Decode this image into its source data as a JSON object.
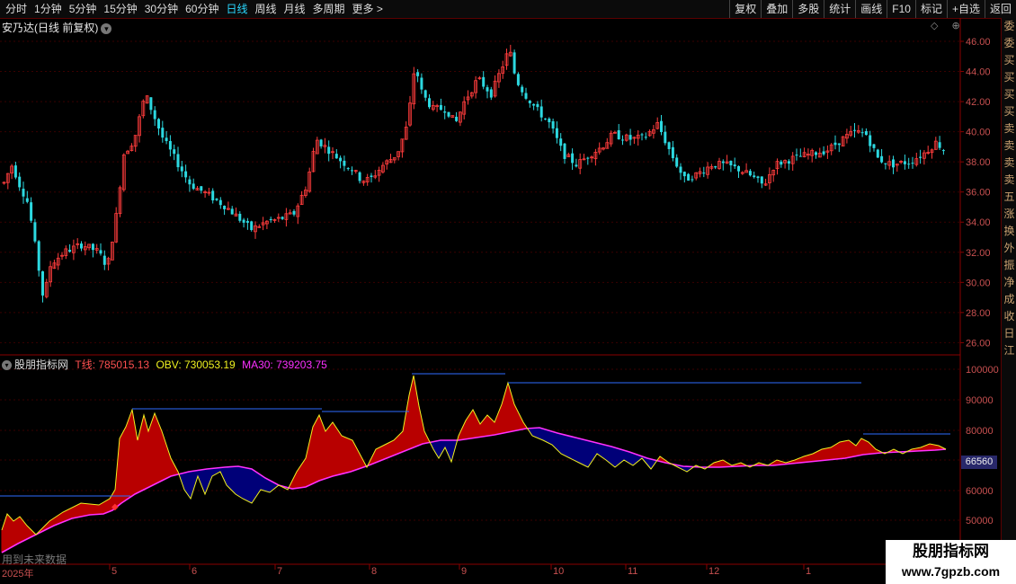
{
  "toolbar": {
    "periods": [
      "分时",
      "1分钟",
      "5分钟",
      "15分钟",
      "30分钟",
      "60分钟",
      "日线",
      "周线",
      "月线",
      "多周期",
      "更多 >"
    ],
    "active_period": "日线",
    "actions": [
      "复权",
      "叠加",
      "多股",
      "统计",
      "画线",
      "F10",
      "标记",
      "+自选",
      "返回"
    ]
  },
  "stock": {
    "title": "安乃达(日线 前复权)",
    "dropdown_glyph": "▾",
    "header_icons": "◇ ⊕"
  },
  "price_axis": {
    "ticks": [
      "46.00",
      "44.00",
      "42.00",
      "40.00",
      "38.00",
      "36.00",
      "34.00",
      "32.00",
      "30.00",
      "28.00",
      "26.00"
    ]
  },
  "indicator": {
    "name": "股朋指标网",
    "t_label": "T线: 785015.13",
    "obv_label": "OBV: 730053.19",
    "ma_label": "MA30: 739203.75",
    "axis_ticks": [
      "100000",
      "90000",
      "80000",
      "70000",
      "60000",
      "50000"
    ],
    "axis_ticks_clipped": [
      "80000",
      "70000"
    ],
    "last_value": "66560"
  },
  "dates": [
    "2025年",
    "5",
    "6",
    "7",
    "8",
    "9",
    "10",
    "11",
    "12",
    "1"
  ],
  "no_future_text": "用到未来数据",
  "watermark": {
    "line1": "股朋指标网",
    "line2": "www.7gpzb.com"
  },
  "side_panel_text": [
    "委",
    "委",
    "买",
    "买",
    "买",
    "买",
    "卖",
    "卖",
    "卖",
    "卖",
    "五",
    "涨",
    "换",
    "外",
    "振",
    "净",
    "成",
    "收",
    "日",
    "江"
  ],
  "colors": {
    "up": "#ff3c3c",
    "down": "#2cd8e0",
    "obv": "#f0f020",
    "ma30": "#ff30ff",
    "fill_up": "#b80000",
    "fill_down": "#000078",
    "level_line": "#2e6cff"
  }
}
